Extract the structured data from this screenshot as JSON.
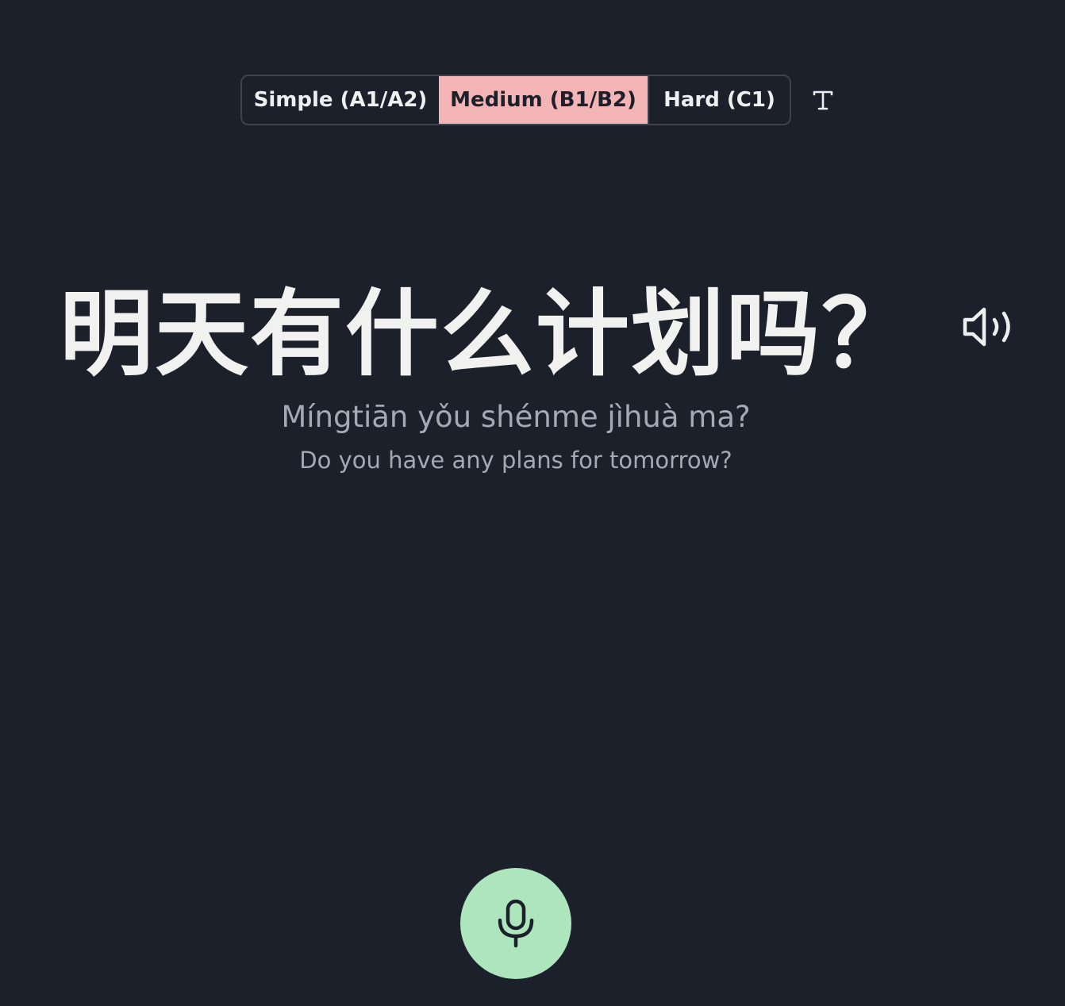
{
  "level_toggle": {
    "options": [
      {
        "label": "Simple (A1/A2)",
        "selected": false
      },
      {
        "label": "Medium (B1/B2)",
        "selected": true
      },
      {
        "label": "Hard (C1)",
        "selected": false
      }
    ]
  },
  "text_size_button": {
    "icon": "text-size-icon"
  },
  "sentence": {
    "hanzi": "明天有什么计划吗？",
    "pinyin": "Míngtiān yǒu shénme jìhuà ma?",
    "translation": "Do you have any plans for tomorrow?"
  },
  "speaker_button": {
    "icon": "speaker-icon"
  },
  "mic_button": {
    "icon": "microphone-icon"
  },
  "colors": {
    "background": "#1c202a",
    "selected_level": "#f2b4b4",
    "mic_button": "#ade6bd",
    "secondary_text": "#a3a9b6"
  }
}
